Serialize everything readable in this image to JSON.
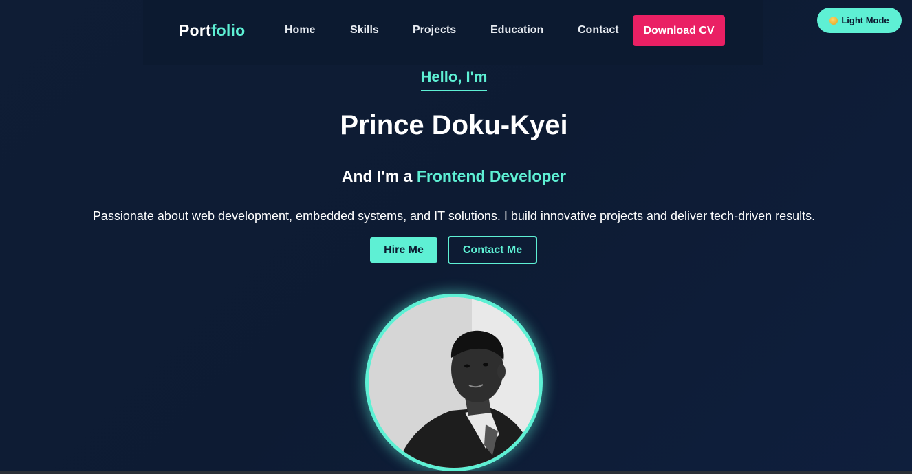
{
  "nav": {
    "logo_part1": "Port",
    "logo_part2": "folio",
    "links": [
      "Home",
      "Skills",
      "Projects",
      "Education",
      "Contact"
    ],
    "download_label": "Download CV"
  },
  "mode_toggle": {
    "label": "Light Mode",
    "icon": "sun-icon"
  },
  "hero": {
    "greeting": "Hello, I'm",
    "name": "Prince Doku-Kyei",
    "role_prefix": "And I'm a ",
    "role_highlight": "Frontend Developer",
    "description": "Passionate about web development, embedded systems, and IT solutions. I build innovative projects and deliver tech-driven results.",
    "hire_label": "Hire Me",
    "contact_label": "Contact Me"
  },
  "colors": {
    "accent": "#5ef0d4",
    "download_button": "#ea2064",
    "background": "#0f1d35",
    "navbar": "#0c1a30"
  }
}
